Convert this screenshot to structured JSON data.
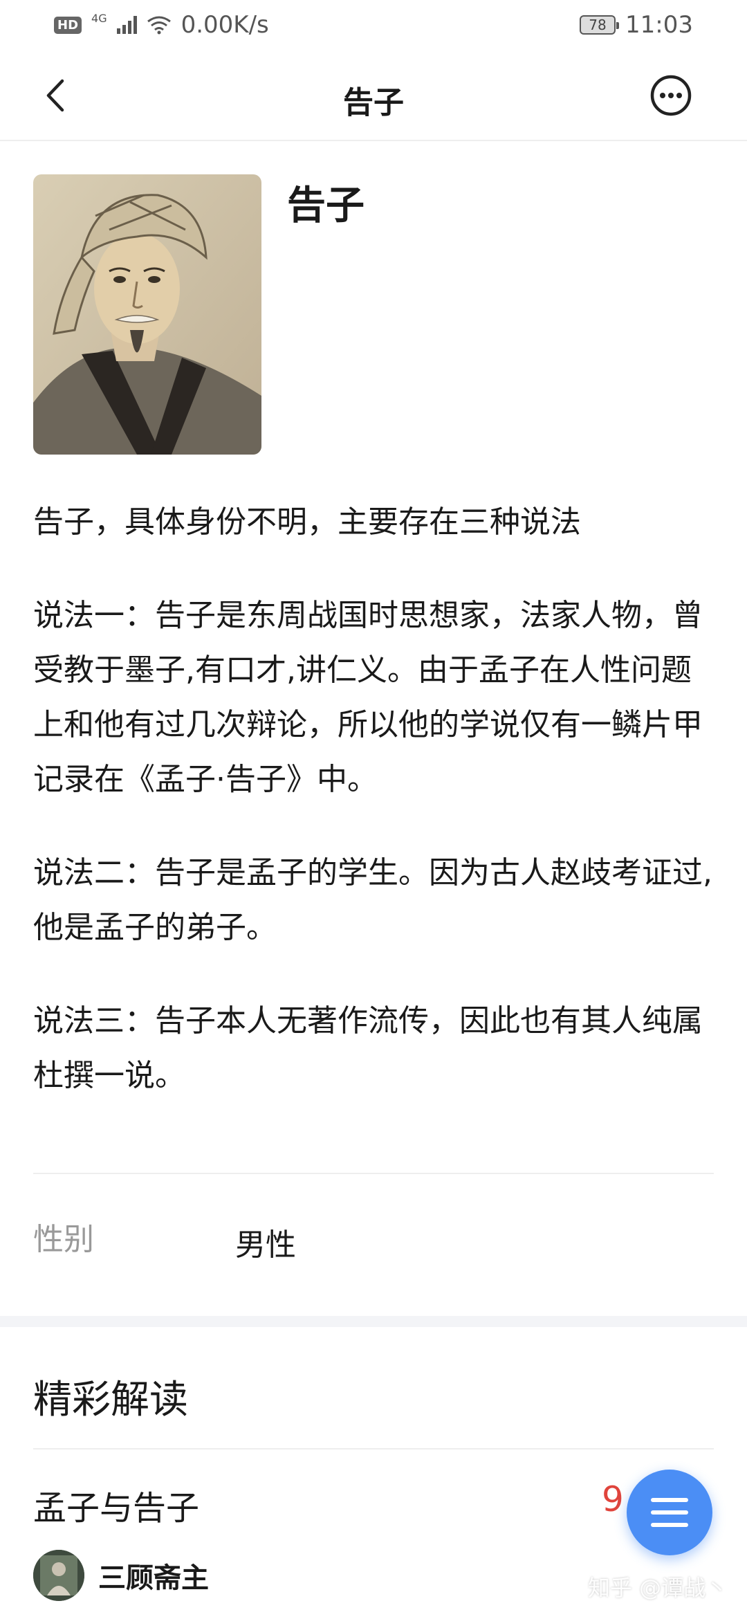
{
  "status_bar": {
    "hd": "HD",
    "network_type": "4G",
    "speed": "0.00K/s",
    "battery": "78",
    "time": "11:03"
  },
  "nav": {
    "title": "告子",
    "back_icon": "chevron-left-icon",
    "more_icon": "more-circle-icon"
  },
  "profile": {
    "name": "告子",
    "portrait_icon": "portrait-image"
  },
  "bio": {
    "paragraphs": [
      "告子，具体身份不明，主要存在三种说法",
      "说法一：告子是东周战国时思想家，法家人物，曾受教于墨子,有口才,讲仁义。由于孟子在人性问题上和他有过几次辩论，所以他的学说仅有一鳞片甲记录在《孟子·告子》中。",
      "说法二：告子是孟子的学生。因为古人赵歧考证过,他是孟子的弟子。",
      "说法三：告子本人无著作流传，因此也有其人纯属杜撰一说。"
    ]
  },
  "attributes": {
    "gender_label": "性别",
    "gender_value": "男性"
  },
  "interpretations": {
    "section_title": "精彩解读",
    "article": {
      "title": "孟子与告子",
      "count": "9",
      "author": "三顾斋主"
    }
  },
  "fab": {
    "icon": "menu-icon"
  },
  "watermark": "知乎 @谭战丶",
  "colors": {
    "accent": "#4b8ef5",
    "count_red": "#e0443c",
    "muted": "#999999"
  }
}
